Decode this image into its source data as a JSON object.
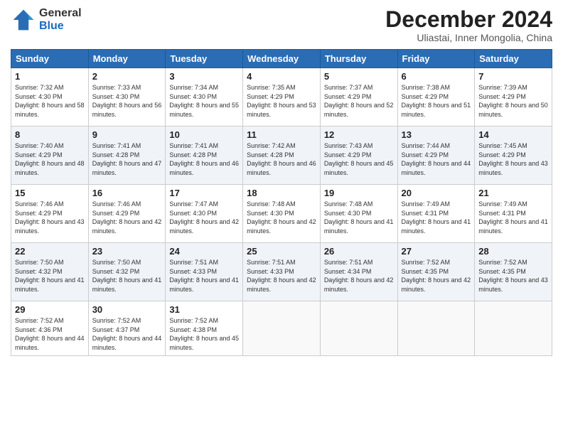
{
  "header": {
    "logo_general": "General",
    "logo_blue": "Blue",
    "title": "December 2024",
    "subtitle": "Uliastai, Inner Mongolia, China"
  },
  "days_of_week": [
    "Sunday",
    "Monday",
    "Tuesday",
    "Wednesday",
    "Thursday",
    "Friday",
    "Saturday"
  ],
  "weeks": [
    [
      {
        "day": "1",
        "sunrise": "7:32 AM",
        "sunset": "4:30 PM",
        "daylight": "8 hours and 58 minutes."
      },
      {
        "day": "2",
        "sunrise": "7:33 AM",
        "sunset": "4:30 PM",
        "daylight": "8 hours and 56 minutes."
      },
      {
        "day": "3",
        "sunrise": "7:34 AM",
        "sunset": "4:30 PM",
        "daylight": "8 hours and 55 minutes."
      },
      {
        "day": "4",
        "sunrise": "7:35 AM",
        "sunset": "4:29 PM",
        "daylight": "8 hours and 53 minutes."
      },
      {
        "day": "5",
        "sunrise": "7:37 AM",
        "sunset": "4:29 PM",
        "daylight": "8 hours and 52 minutes."
      },
      {
        "day": "6",
        "sunrise": "7:38 AM",
        "sunset": "4:29 PM",
        "daylight": "8 hours and 51 minutes."
      },
      {
        "day": "7",
        "sunrise": "7:39 AM",
        "sunset": "4:29 PM",
        "daylight": "8 hours and 50 minutes."
      }
    ],
    [
      {
        "day": "8",
        "sunrise": "7:40 AM",
        "sunset": "4:29 PM",
        "daylight": "8 hours and 48 minutes."
      },
      {
        "day": "9",
        "sunrise": "7:41 AM",
        "sunset": "4:28 PM",
        "daylight": "8 hours and 47 minutes."
      },
      {
        "day": "10",
        "sunrise": "7:41 AM",
        "sunset": "4:28 PM",
        "daylight": "8 hours and 46 minutes."
      },
      {
        "day": "11",
        "sunrise": "7:42 AM",
        "sunset": "4:28 PM",
        "daylight": "8 hours and 46 minutes."
      },
      {
        "day": "12",
        "sunrise": "7:43 AM",
        "sunset": "4:29 PM",
        "daylight": "8 hours and 45 minutes."
      },
      {
        "day": "13",
        "sunrise": "7:44 AM",
        "sunset": "4:29 PM",
        "daylight": "8 hours and 44 minutes."
      },
      {
        "day": "14",
        "sunrise": "7:45 AM",
        "sunset": "4:29 PM",
        "daylight": "8 hours and 43 minutes."
      }
    ],
    [
      {
        "day": "15",
        "sunrise": "7:46 AM",
        "sunset": "4:29 PM",
        "daylight": "8 hours and 43 minutes."
      },
      {
        "day": "16",
        "sunrise": "7:46 AM",
        "sunset": "4:29 PM",
        "daylight": "8 hours and 42 minutes."
      },
      {
        "day": "17",
        "sunrise": "7:47 AM",
        "sunset": "4:30 PM",
        "daylight": "8 hours and 42 minutes."
      },
      {
        "day": "18",
        "sunrise": "7:48 AM",
        "sunset": "4:30 PM",
        "daylight": "8 hours and 42 minutes."
      },
      {
        "day": "19",
        "sunrise": "7:48 AM",
        "sunset": "4:30 PM",
        "daylight": "8 hours and 41 minutes."
      },
      {
        "day": "20",
        "sunrise": "7:49 AM",
        "sunset": "4:31 PM",
        "daylight": "8 hours and 41 minutes."
      },
      {
        "day": "21",
        "sunrise": "7:49 AM",
        "sunset": "4:31 PM",
        "daylight": "8 hours and 41 minutes."
      }
    ],
    [
      {
        "day": "22",
        "sunrise": "7:50 AM",
        "sunset": "4:32 PM",
        "daylight": "8 hours and 41 minutes."
      },
      {
        "day": "23",
        "sunrise": "7:50 AM",
        "sunset": "4:32 PM",
        "daylight": "8 hours and 41 minutes."
      },
      {
        "day": "24",
        "sunrise": "7:51 AM",
        "sunset": "4:33 PM",
        "daylight": "8 hours and 41 minutes."
      },
      {
        "day": "25",
        "sunrise": "7:51 AM",
        "sunset": "4:33 PM",
        "daylight": "8 hours and 42 minutes."
      },
      {
        "day": "26",
        "sunrise": "7:51 AM",
        "sunset": "4:34 PM",
        "daylight": "8 hours and 42 minutes."
      },
      {
        "day": "27",
        "sunrise": "7:52 AM",
        "sunset": "4:35 PM",
        "daylight": "8 hours and 42 minutes."
      },
      {
        "day": "28",
        "sunrise": "7:52 AM",
        "sunset": "4:35 PM",
        "daylight": "8 hours and 43 minutes."
      }
    ],
    [
      {
        "day": "29",
        "sunrise": "7:52 AM",
        "sunset": "4:36 PM",
        "daylight": "8 hours and 44 minutes."
      },
      {
        "day": "30",
        "sunrise": "7:52 AM",
        "sunset": "4:37 PM",
        "daylight": "8 hours and 44 minutes."
      },
      {
        "day": "31",
        "sunrise": "7:52 AM",
        "sunset": "4:38 PM",
        "daylight": "8 hours and 45 minutes."
      },
      null,
      null,
      null,
      null
    ]
  ],
  "labels": {
    "sunrise": "Sunrise:",
    "sunset": "Sunset:",
    "daylight": "Daylight:"
  }
}
